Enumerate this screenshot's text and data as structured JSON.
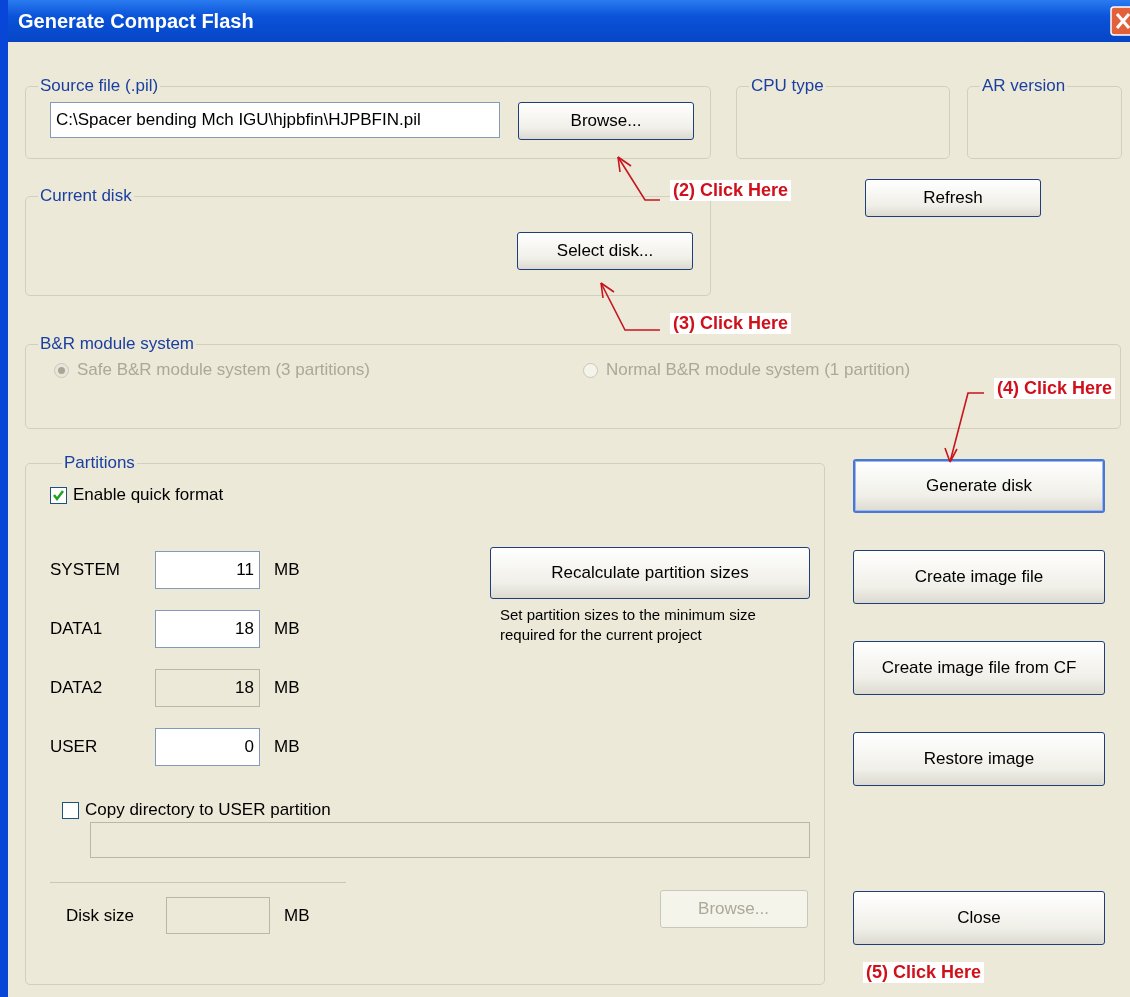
{
  "window": {
    "title": "Generate Compact Flash"
  },
  "source_file": {
    "label": "Source file (.pil)",
    "value": "C:\\Spacer bending Mch IGU\\hjpbfin\\HJPBFIN.pil",
    "browse_button": "Browse..."
  },
  "cpu_type": {
    "label": "CPU type"
  },
  "ar_version": {
    "label": "AR version"
  },
  "refresh_button": "Refresh",
  "current_disk": {
    "label": "Current disk",
    "select_button": "Select disk..."
  },
  "module_system": {
    "label": "B&R module system",
    "disabled": true,
    "options": [
      {
        "label": "Safe B&R module system (3 partitions)",
        "selected": true
      },
      {
        "label": "Normal B&R module system (1 partition)",
        "selected": false
      }
    ]
  },
  "partitions": {
    "label": "Partitions",
    "quick_format": {
      "label": "Enable quick format",
      "checked": true
    },
    "rows": [
      {
        "name": "SYSTEM",
        "value": "11",
        "unit": "MB",
        "disabled": false
      },
      {
        "name": "DATA1",
        "value": "18",
        "unit": "MB",
        "disabled": false
      },
      {
        "name": "DATA2",
        "value": "18",
        "unit": "MB",
        "disabled": true
      },
      {
        "name": "USER",
        "value": "0",
        "unit": "MB",
        "disabled": false
      }
    ],
    "recalc_button": "Recalculate partition sizes",
    "recalc_note": "Set partition sizes to the minimum size required for the current project",
    "copy_directory": {
      "label": "Copy directory to USER partition",
      "checked": false
    },
    "directory_field": {
      "disabled": true
    },
    "browse_button": {
      "label": "Browse...",
      "disabled": true
    },
    "disk_size": {
      "label": "Disk size",
      "unit": "MB",
      "disabled": true
    }
  },
  "actions": [
    {
      "label": "Generate disk",
      "focused": true
    },
    {
      "label": "Create image file",
      "focused": false
    },
    {
      "label": "Create image file from CF",
      "focused": false
    },
    {
      "label": "Restore image",
      "focused": false
    },
    {
      "label": "Close",
      "focused": false
    }
  ],
  "annotations": [
    {
      "label": "(2) Click Here"
    },
    {
      "label": "(3) Click Here"
    },
    {
      "label": "(4) Click Here"
    },
    {
      "label": "(5) Click Here"
    }
  ]
}
